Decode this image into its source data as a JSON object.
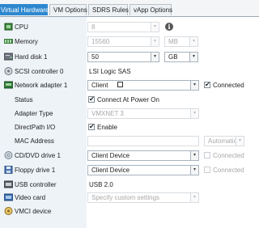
{
  "tabs": [
    {
      "label": "Virtual Hardware"
    },
    {
      "label": "VM Options"
    },
    {
      "label": "SDRS Rules"
    },
    {
      "label": "vApp Options"
    }
  ],
  "rows": {
    "cpu": {
      "label": "CPU",
      "value": "8",
      "icon": "cpu-icon"
    },
    "memory": {
      "label": "Memory",
      "value": "15560",
      "unit": "MB",
      "icon": "memory-icon"
    },
    "hard_disk": {
      "label": "Hard disk 1",
      "value": "50",
      "unit": "GB",
      "icon": "hard-disk-icon"
    },
    "scsi": {
      "label": "SCSI controller 0",
      "value": "LSI Logic SAS",
      "icon": "scsi-controller-icon"
    },
    "network": {
      "label": "Network adapter 1",
      "value": "Client",
      "connected_label": "Connected",
      "icon": "network-adapter-icon"
    },
    "status": {
      "label": "Status",
      "value": "Connect At Power On"
    },
    "adapter_type": {
      "label": "Adapter Type",
      "value": "VMXNET 3"
    },
    "directpath": {
      "label": "DirectPath I/O",
      "value": "Enable"
    },
    "mac": {
      "label": "MAC Address",
      "value": "Automatic"
    },
    "cd_dvd": {
      "label": "CD/DVD drive 1",
      "value": "Client Device",
      "connected_label": "Connected",
      "icon": "cd-dvd-icon"
    },
    "floppy": {
      "label": "Floppy drive 1",
      "value": "Client Device",
      "connected_label": "Connected",
      "icon": "floppy-icon"
    },
    "usb": {
      "label": "USB controller",
      "value": "USB 2.0",
      "icon": "usb-controller-icon"
    },
    "video": {
      "label": "Video card",
      "value": "Specify custom settings",
      "icon": "video-card-icon"
    },
    "vmci": {
      "label": "VMCI device",
      "icon": "vmci-device-icon"
    }
  },
  "info_glyph": "i",
  "check_glyph": "✔",
  "dropdown_glyph": "▾",
  "colors": {
    "accent": "#2e88cf",
    "label_column": "#eef3f8"
  }
}
